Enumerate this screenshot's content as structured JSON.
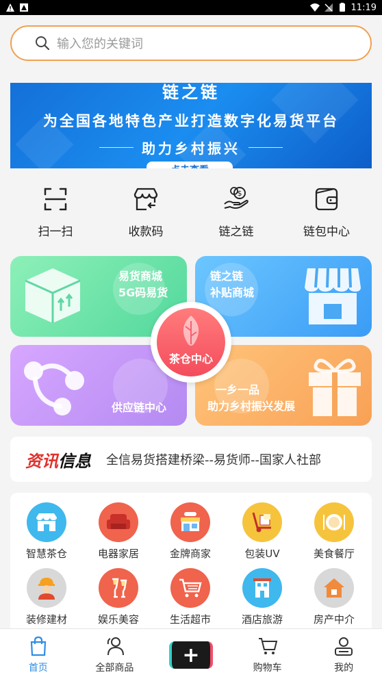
{
  "status_bar": {
    "time": "11:19"
  },
  "search": {
    "placeholder": "输入您的关键词"
  },
  "banner": {
    "title": "链之链",
    "line1": "为全国各地特色产业打造数字化易货平台",
    "line2": "助力乡村振兴",
    "button": "点击查看"
  },
  "quick_actions": [
    {
      "label": "扫一扫",
      "icon": "scan-icon"
    },
    {
      "label": "收款码",
      "icon": "shop-icon"
    },
    {
      "label": "链之链",
      "icon": "money-hand-icon"
    },
    {
      "label": "链包中心",
      "icon": "wallet-icon"
    }
  ],
  "feature_cards": {
    "card1": {
      "line1": "易货商城",
      "line2": "5G码易货"
    },
    "card2": {
      "line1": "链之链",
      "line2": "补贴商城"
    },
    "card3": {
      "line1": "供应链中心"
    },
    "card4": {
      "line1": "一乡一品",
      "line2": "助力乡村振兴发展"
    },
    "center": "茶仓中心"
  },
  "news": {
    "badge_red": "资讯",
    "badge_black": "信息",
    "text": "全信易货搭建桥梁--易货师--国家人社部"
  },
  "categories": [
    {
      "label": "智慧茶仓",
      "color": "#3fb8ee"
    },
    {
      "label": "电器家居",
      "color": "#f0634c"
    },
    {
      "label": "金牌商家",
      "color": "#f0634c"
    },
    {
      "label": "包装UV",
      "color": "#f6c43c"
    },
    {
      "label": "美食餐厅",
      "color": "#f6c43c"
    },
    {
      "label": "装修建材",
      "color": "#d8d8d8"
    },
    {
      "label": "娱乐美容",
      "color": "#f0634c"
    },
    {
      "label": "生活超市",
      "color": "#f0634c"
    },
    {
      "label": "酒店旅游",
      "color": "#3fb8ee"
    },
    {
      "label": "房产中介",
      "color": "#d8d8d8"
    }
  ],
  "bottom_nav": [
    {
      "label": "首页",
      "active": true
    },
    {
      "label": "全部商品"
    },
    {
      "label": ""
    },
    {
      "label": "购物车"
    },
    {
      "label": "我的"
    }
  ],
  "colors": {
    "accent": "#2e8de6",
    "search_border": "#f0a050",
    "news_red": "#e0322d"
  }
}
